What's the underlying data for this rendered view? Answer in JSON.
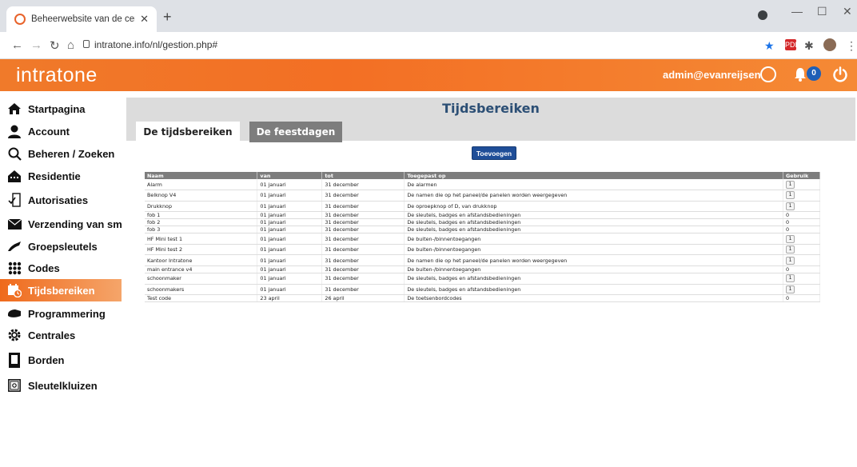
{
  "browser": {
    "tab_title": "Beheerwebsite van de centrales",
    "url": "intratone.info/nl/gestion.php#",
    "pdf_ext": "PDF"
  },
  "header": {
    "logo": "intratone",
    "user": "admin@evanreijsen",
    "notifications": "0",
    "colors": {
      "bar": "#f36f24",
      "badge": "#1f5fb6"
    }
  },
  "sidebar": {
    "items": [
      {
        "label": "Startpagina",
        "icon": "home-icon"
      },
      {
        "label": "Account",
        "icon": "user-icon"
      },
      {
        "label": "Beheren / Zoeken",
        "icon": "search-icon"
      },
      {
        "label": "Residentie",
        "icon": "residence-icon"
      },
      {
        "label": "Autorisaties",
        "icon": "authorization-icon"
      },
      {
        "label": "Verzending van sms",
        "icon": "mail-icon"
      },
      {
        "label": "Groepsleutels",
        "icon": "key-icon"
      },
      {
        "label": "Codes",
        "icon": "keypad-icon"
      },
      {
        "label": "Tijdsbereiken",
        "icon": "calendar-clock-icon",
        "active": true
      },
      {
        "label": "Programmering",
        "icon": "programming-icon"
      },
      {
        "label": "Centrales",
        "icon": "gear-icon"
      },
      {
        "label": "Borden",
        "icon": "panel-icon"
      },
      {
        "label": "Sleutelkluizen",
        "icon": "safe-icon"
      }
    ]
  },
  "main": {
    "title": "Tijdsbereiken",
    "tabs": [
      "De tijdsbereiken",
      "De feestdagen"
    ],
    "add_button": "Toevoegen",
    "table": {
      "headers": [
        "Naam",
        "van",
        "tot",
        "Toegepast op",
        "Gebruik"
      ],
      "rows": [
        {
          "naam": "Alarm",
          "van": "01 januari",
          "tot": "31 december",
          "toegepast": "De alarmen",
          "gebruik": "1",
          "button": true
        },
        {
          "naam": "Belknop V4",
          "van": "01 januari",
          "tot": "31 december",
          "toegepast": "De namen die op het paneel/de panelen worden weergegeven",
          "gebruik": "1",
          "button": true
        },
        {
          "naam": "Drukknop",
          "van": "01 januari",
          "tot": "31 december",
          "toegepast": "De oproepknop of D, van drukknop",
          "gebruik": "1",
          "button": true
        },
        {
          "naam": "fob 1",
          "van": "01 januari",
          "tot": "31 december",
          "toegepast": "De sleutels, badges en afstandsbedieningen",
          "gebruik": "0",
          "button": false
        },
        {
          "naam": "fob 2",
          "van": "01 januari",
          "tot": "31 december",
          "toegepast": "De sleutels, badges en afstandsbedieningen",
          "gebruik": "0",
          "button": false
        },
        {
          "naam": "fob 3",
          "van": "01 januari",
          "tot": "31 december",
          "toegepast": "De sleutels, badges en afstandsbedieningen",
          "gebruik": "0",
          "button": false
        },
        {
          "naam": "HF Mini test 1",
          "van": "01 januari",
          "tot": "31 december",
          "toegepast": "De buiten-/binnentoegangen",
          "gebruik": "1",
          "button": true
        },
        {
          "naam": "HF Mini test 2",
          "van": "01 januari",
          "tot": "31 december",
          "toegepast": "De buiten-/binnentoegangen",
          "gebruik": "1",
          "button": true
        },
        {
          "naam": "Kantoor Intratone",
          "van": "01 januari",
          "tot": "31 december",
          "toegepast": "De namen die op het paneel/de panelen worden weergegeven",
          "gebruik": "1",
          "button": true
        },
        {
          "naam": "main entrance v4",
          "van": "01 januari",
          "tot": "31 december",
          "toegepast": "De buiten-/binnentoegangen",
          "gebruik": "0",
          "button": false
        },
        {
          "naam": "schoonmaker",
          "van": "01 januari",
          "tot": "31 december",
          "toegepast": "De sleutels, badges en afstandsbedieningen",
          "gebruik": "1",
          "button": true
        },
        {
          "naam": "schoonmakers",
          "van": "01 januari",
          "tot": "31 december",
          "toegepast": "De sleutels, badges en afstandsbedieningen",
          "gebruik": "1",
          "button": true
        },
        {
          "naam": "Test code",
          "van": "23 april",
          "tot": "26 april",
          "toegepast": "De toetsenbordcodes",
          "gebruik": "0",
          "button": false
        }
      ]
    }
  }
}
